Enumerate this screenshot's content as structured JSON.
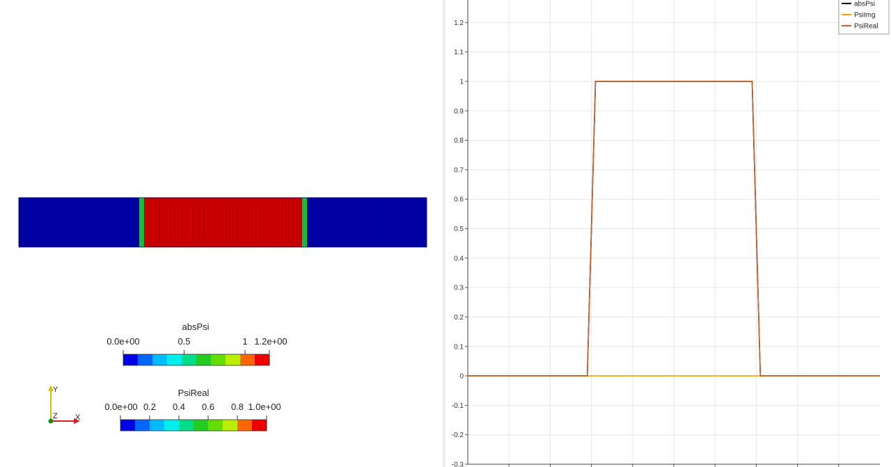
{
  "render_view": {
    "colorbars": [
      {
        "title": "absPsi",
        "labels": [
          "0.0e+00",
          "0.5",
          "1",
          "1.2e+00"
        ],
        "label_values": [
          0,
          0.5,
          1,
          1.2
        ],
        "range": [
          0,
          1.2
        ],
        "colors": [
          "#0000e6",
          "#0066ff",
          "#00bbff",
          "#00eeee",
          "#00dd88",
          "#22cc22",
          "#66dd00",
          "#bbee00",
          "#ff6600",
          "#ee0000"
        ]
      },
      {
        "title": "PsiReal",
        "labels": [
          "0.0e+00",
          "0.2",
          "0.4",
          "0.6",
          "0.8",
          "1.0e+00"
        ],
        "label_values": [
          0,
          0.2,
          0.4,
          0.6,
          0.8,
          1.0
        ],
        "range": [
          0,
          1.0
        ],
        "colors": [
          "#0000e6",
          "#0066ff",
          "#00bbff",
          "#00eeee",
          "#00dd88",
          "#22cc22",
          "#66dd00",
          "#bbee00",
          "#ff6600",
          "#ee0000"
        ]
      }
    ],
    "axes_triad": {
      "labels": [
        "Y",
        "Z",
        "X"
      ],
      "colors": {
        "x": "#d62020",
        "y": "#d4c400",
        "z": "#1a8a1a"
      }
    },
    "field_colors": {
      "low": "#0000a8",
      "high": "#cc0000",
      "edge": "#22bb44"
    }
  },
  "chart_data": {
    "type": "line",
    "xlim": [
      -5,
      5
    ],
    "ylim": [
      -0.3,
      1.3
    ],
    "yticks": [
      -0.3,
      -0.2,
      -0.1,
      0,
      0.1,
      0.2,
      0.3,
      0.4,
      0.5,
      0.6,
      0.7,
      0.8,
      0.9,
      1,
      1.1,
      1.2
    ],
    "ytick_labels": [
      "-0.3",
      "-0.2",
      "-0.1",
      "0",
      "0.1",
      "0.2",
      "0.3",
      "0.4",
      "0.5",
      "0.6",
      "0.7",
      "0.8",
      "0.9",
      "1",
      "1.1",
      "1.2"
    ],
    "xticks": [
      -4,
      -3,
      -2,
      -1,
      0,
      1,
      2,
      3,
      4
    ],
    "grid": true,
    "legend_position": "top-right",
    "series": [
      {
        "name": "absPsi",
        "color": "#000000",
        "x": [
          -5,
          -2.1,
          -1.9,
          1.9,
          2.1,
          5
        ],
        "y": [
          0,
          0,
          1,
          1,
          0,
          0
        ]
      },
      {
        "name": "PsiImg",
        "color": "#f5a000",
        "x": [
          -5,
          5
        ],
        "y": [
          0,
          0
        ]
      },
      {
        "name": "PsiReal",
        "color": "#c8622a",
        "x": [
          -5,
          -2.1,
          -1.9,
          1.9,
          2.1,
          5
        ],
        "y": [
          0,
          0,
          1,
          1,
          0,
          0
        ]
      }
    ]
  }
}
